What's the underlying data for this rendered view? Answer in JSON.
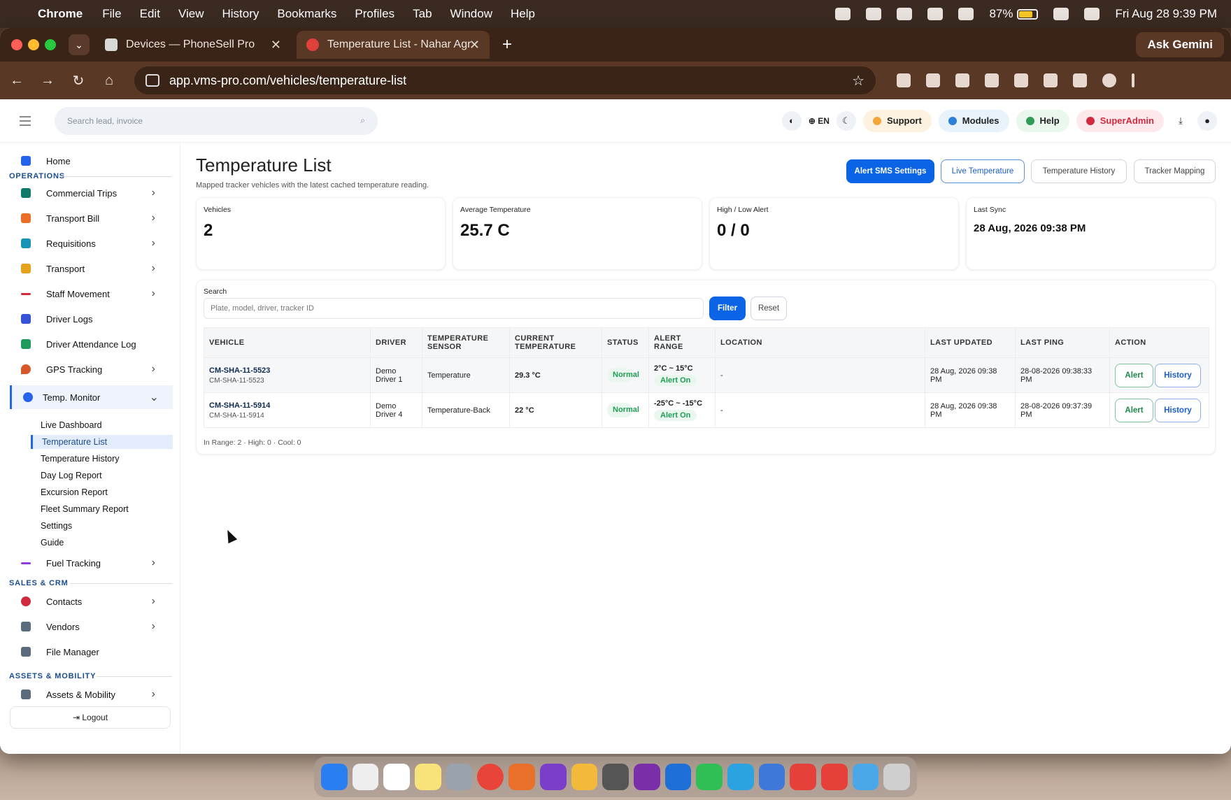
{
  "menubar": {
    "app": "Chrome",
    "items": [
      "File",
      "Edit",
      "View",
      "History",
      "Bookmarks",
      "Profiles",
      "Tab",
      "Window",
      "Help"
    ],
    "battery": "87%",
    "clock": "Fri Aug 28  9:39 PM"
  },
  "browser": {
    "tabs": [
      {
        "title": "Devices — PhoneSell Pro"
      },
      {
        "title": "Temperature List - Nahar Agr"
      }
    ],
    "url": "app.vms-pro.com/vehicles/temperature-list",
    "gemini": "Ask Gemini"
  },
  "header": {
    "search_placeholder": "Search lead, invoice",
    "lang": "EN",
    "pills": [
      "Support",
      "Modules",
      "Help",
      "SuperAdmin"
    ]
  },
  "sidebar": {
    "home": "Home",
    "sections": {
      "operations": "OPERATIONS",
      "sales": "SALES & CRM",
      "assets": "ASSETS & MOBILITY"
    },
    "items": [
      {
        "label": "Commercial Trips",
        "color": "#0f7a6a"
      },
      {
        "label": "Transport Bill",
        "color": "#e8702a"
      },
      {
        "label": "Requisitions",
        "color": "#1793b5"
      },
      {
        "label": "Transport",
        "color": "#e6a21e"
      },
      {
        "label": "Staff Movement",
        "color": "#d12a3e"
      },
      {
        "label": "Driver Logs",
        "color": "#3552d9"
      },
      {
        "label": "Driver Attendance Log",
        "color": "#1e9a5a"
      },
      {
        "label": "GPS Tracking",
        "color": "#d8572a"
      },
      {
        "label": "Temp. Monitor",
        "color": "#2563eb"
      }
    ],
    "subitems": [
      "Live Dashboard",
      "Temperature List",
      "Temperature History",
      "Day Log Report",
      "Excursion Report",
      "Fleet Summary Report",
      "Settings",
      "Guide"
    ],
    "fuel": "Fuel Tracking",
    "sales_items": [
      "Contacts",
      "Vendors",
      "File Manager"
    ],
    "assets_items": [
      "Assets & Mobility"
    ],
    "logout": "Logout"
  },
  "page": {
    "title": "Temperature List",
    "subtitle": "Mapped tracker vehicles with the latest cached temperature reading.",
    "buttons": [
      "Alert SMS Settings",
      "Live Temperature",
      "Temperature History",
      "Tracker Mapping"
    ]
  },
  "stats": [
    {
      "label": "Vehicles",
      "value": "2"
    },
    {
      "label": "Average Temperature",
      "value": "25.7 C"
    },
    {
      "label": "High / Low Alert",
      "value": "0 / 0"
    },
    {
      "label": "Last Sync",
      "value": "28 Aug, 2026 09:38 PM"
    }
  ],
  "filter": {
    "label": "Search",
    "placeholder": "Plate, model, driver, tracker ID",
    "filter_btn": "Filter",
    "reset_btn": "Reset"
  },
  "table": {
    "headers": [
      "VEHICLE",
      "DRIVER",
      "TEMPERATURE SENSOR",
      "CURRENT TEMPERATURE",
      "STATUS",
      "ALERT RANGE",
      "LOCATION",
      "LAST UPDATED",
      "LAST PING",
      "ACTION"
    ],
    "rows": [
      {
        "plate": "CM-SHA-11-5523",
        "plate_sub": "CM-SHA-11-5523",
        "driver": "Demo Driver 1",
        "sensor": "Temperature",
        "temp": "29.3 °C",
        "status": "Normal",
        "range": "2°C ~ 15°C",
        "alert": "Alert On",
        "location": "-",
        "updated": "28 Aug, 2026 09:38 PM",
        "ping": "28-08-2026 09:38:33 PM"
      },
      {
        "plate": "CM-SHA-11-5914",
        "plate_sub": "CM-SHA-11-5914",
        "driver": "Demo Driver 4",
        "sensor": "Temperature-Back",
        "temp": "22 °C",
        "status": "Normal",
        "range": "-25°C ~ -15°C",
        "alert": "Alert On",
        "location": "-",
        "updated": "28 Aug, 2026 09:38 PM",
        "ping": "28-08-2026 09:37:39 PM"
      }
    ],
    "action_alert": "Alert",
    "action_history": "History",
    "footer": "In Range: 2 · High: 0 · Cool: 0"
  }
}
